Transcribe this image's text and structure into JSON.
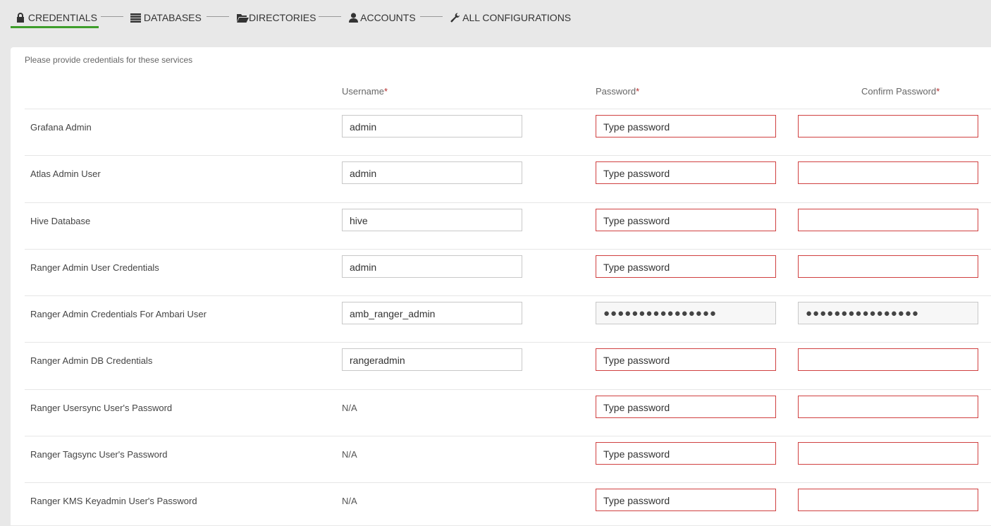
{
  "tabs": [
    {
      "label": "CREDENTIALS",
      "icon": "lock-icon",
      "active": true
    },
    {
      "label": "DATABASES",
      "icon": "list-icon",
      "active": false
    },
    {
      "label": "DIRECTORIES",
      "icon": "folder-open-icon",
      "active": false
    },
    {
      "label": "ACCOUNTS",
      "icon": "user-icon",
      "active": false
    },
    {
      "label": "ALL CONFIGURATIONS",
      "icon": "wrench-icon",
      "active": false
    }
  ],
  "intro": "Please provide credentials for these services",
  "headers": {
    "username": "Username",
    "password": "Password",
    "confirm": "Confirm Password",
    "required_mark": "*"
  },
  "colors": {
    "active_tab": "#3e9e2b",
    "error_border": "#d04040",
    "required": "#b52b2b"
  },
  "rows": [
    {
      "label": "Grafana Admin",
      "username": "admin",
      "password_placeholder": "Type password",
      "password_mask": "",
      "confirm_mask": ""
    },
    {
      "label": "Atlas Admin User",
      "username": "admin",
      "password_placeholder": "Type password",
      "password_mask": "",
      "confirm_mask": ""
    },
    {
      "label": "Hive Database",
      "username": "hive",
      "password_placeholder": "Type password",
      "password_mask": "",
      "confirm_mask": ""
    },
    {
      "label": "Ranger Admin User Credentials",
      "username": "admin",
      "password_placeholder": "Type password",
      "password_mask": "",
      "confirm_mask": ""
    },
    {
      "label": "Ranger Admin Credentials For Ambari User",
      "username": "amb_ranger_admin",
      "password_placeholder": "",
      "password_mask": "●●●●●●●●●●●●●●●●",
      "confirm_mask": "●●●●●●●●●●●●●●●●"
    },
    {
      "label": "Ranger Admin DB Credentials",
      "username": "rangeradmin",
      "password_placeholder": "Type password",
      "password_mask": "",
      "confirm_mask": ""
    },
    {
      "label": "Ranger Usersync User's Password",
      "username_na": "N/A",
      "password_placeholder": "Type password",
      "password_mask": "",
      "confirm_mask": ""
    },
    {
      "label": "Ranger Tagsync User's Password",
      "username_na": "N/A",
      "password_placeholder": "Type password",
      "password_mask": "",
      "confirm_mask": ""
    },
    {
      "label": "Ranger KMS Keyadmin User's Password",
      "username_na": "N/A",
      "password_placeholder": "Type password",
      "password_mask": "",
      "confirm_mask": ""
    }
  ]
}
